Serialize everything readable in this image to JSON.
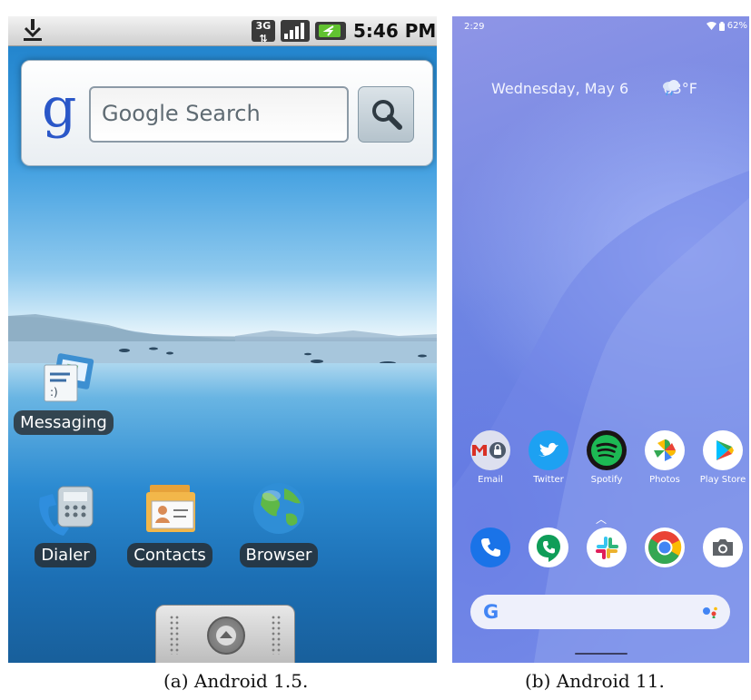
{
  "android15": {
    "time": "5:46 PM",
    "network_badge": "3G",
    "search_placeholder": "Google Search",
    "google_logo": "g",
    "apps": {
      "messaging": "Messaging",
      "dialer": "Dialer",
      "contacts": "Contacts",
      "browser": "Browser"
    },
    "icons": [
      "download-icon",
      "3g-icon",
      "signal-icon",
      "battery-icon",
      "search-icon",
      "messaging-icon",
      "dialer-icon",
      "contacts-icon",
      "browser-globe-icon",
      "app-drawer-icon"
    ]
  },
  "android11": {
    "time": "2:29",
    "battery": "62%",
    "date_weather": "Wednesday, May 6",
    "temperature": "63°F",
    "row1": [
      {
        "label": "Email",
        "icon": "email-icon"
      },
      {
        "label": "Twitter",
        "icon": "twitter-icon"
      },
      {
        "label": "Spotify",
        "icon": "spotify-icon"
      },
      {
        "label": "Photos",
        "icon": "photos-icon"
      },
      {
        "label": "Play Store",
        "icon": "play-store-icon"
      }
    ],
    "dock": [
      "phone-icon",
      "hangouts-icon",
      "slack-icon",
      "chrome-icon",
      "camera-icon"
    ],
    "search_logo": "G"
  },
  "captions": {
    "left": "(a) Android 1.5.",
    "right": "(b) Android 11."
  },
  "colors": {
    "android15_search_blue": "#2a57c8",
    "android11_wallpaper": "#7c8ce6",
    "twitter": "#1da1f2",
    "spotify": "#1db954",
    "hangouts": "#0f9d58"
  }
}
